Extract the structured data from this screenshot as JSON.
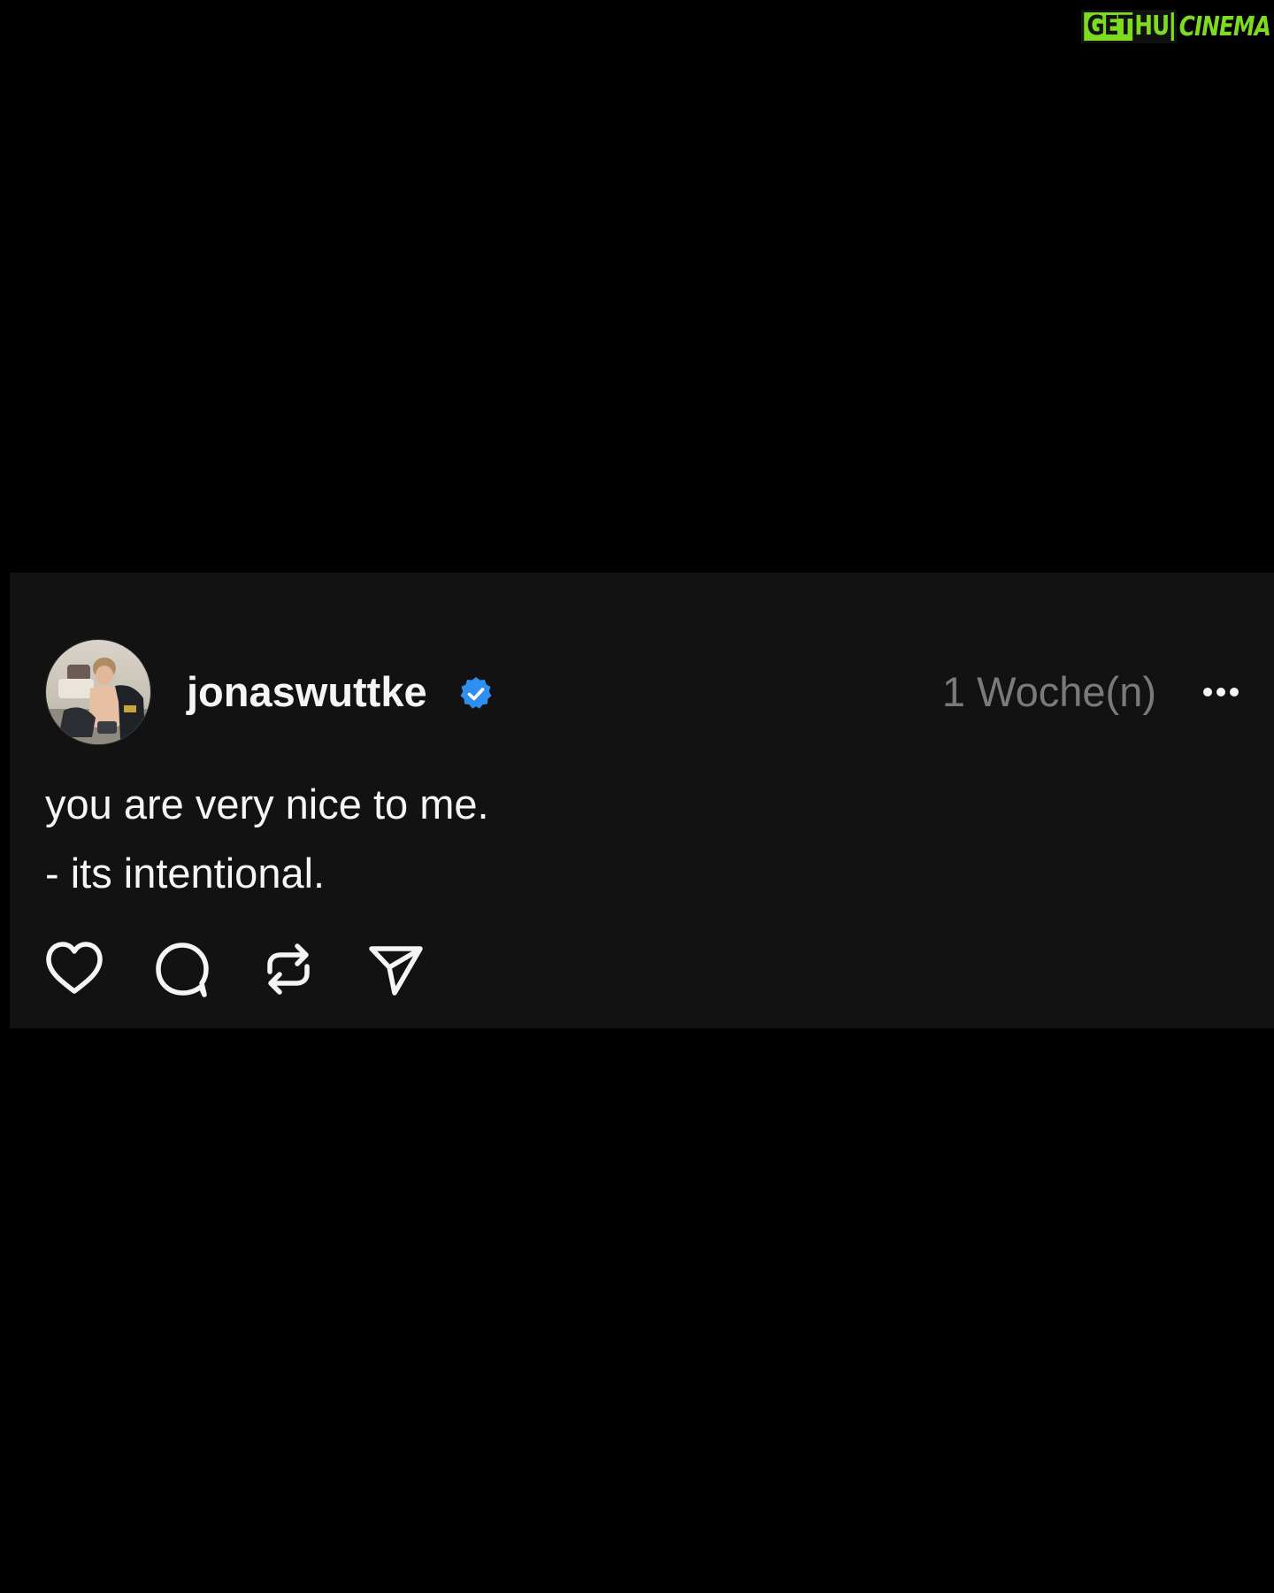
{
  "watermark": {
    "part1": "GET",
    "part2": "HU",
    "part3": "CINEMA"
  },
  "post": {
    "author": {
      "username": "jonaswuttke",
      "verified": true,
      "verified_color": "#2f8ef0"
    },
    "timestamp": "1 Woche(n)",
    "text_lines": [
      "you are very nice to me.",
      "- its intentional."
    ],
    "actions": [
      {
        "icon": "heart-icon"
      },
      {
        "icon": "comment-icon"
      },
      {
        "icon": "repost-icon"
      },
      {
        "icon": "share-icon"
      }
    ],
    "more_icon": "more-options-icon"
  },
  "colors": {
    "background": "#000000",
    "card": "#121212",
    "text": "#f5f5f5",
    "muted": "#7a7a7a",
    "watermark_green": "#7ddc1f"
  }
}
